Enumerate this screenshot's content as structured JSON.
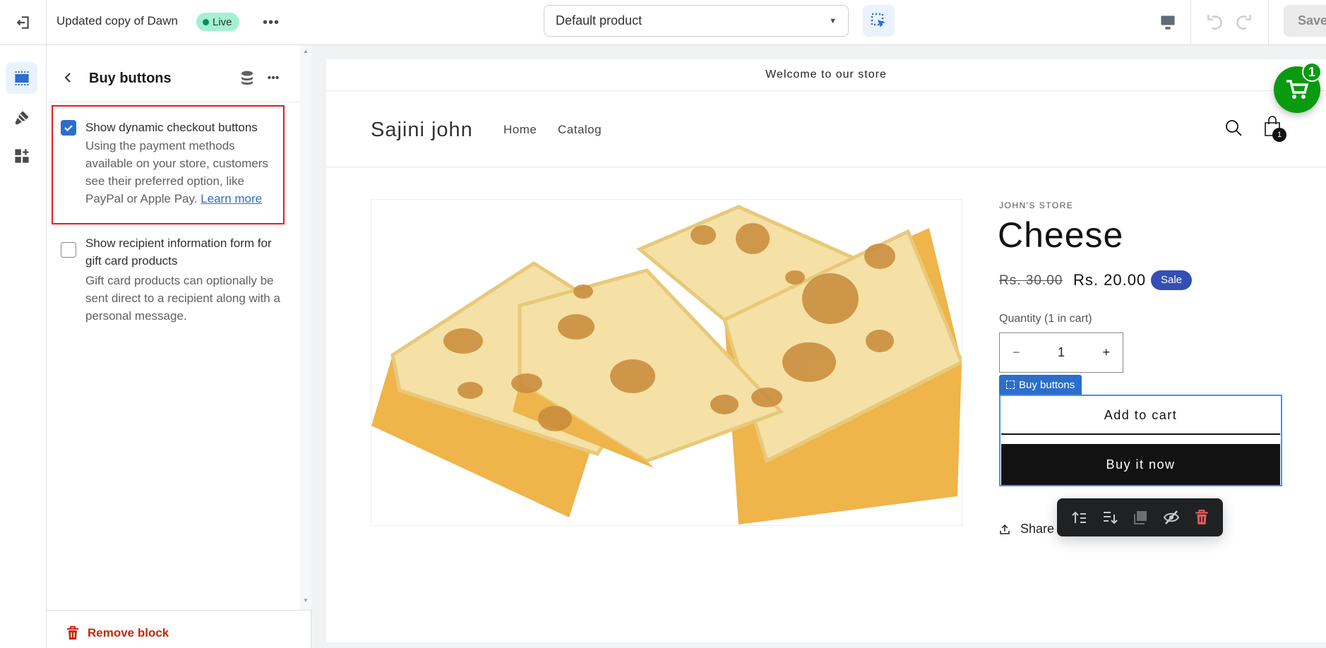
{
  "topbar": {
    "theme_name": "Updated copy of Dawn",
    "status_badge": "Live",
    "template_select": "Default product",
    "save_label": "Save"
  },
  "panel": {
    "title": "Buy buttons",
    "settings": [
      {
        "label": "Show dynamic checkout buttons",
        "checked": true,
        "description": "Using the payment methods available on your store, customers see their preferred option, like PayPal or Apple Pay.",
        "link": "Learn more"
      },
      {
        "label": "Show recipient information form for gift card products",
        "checked": false,
        "description": "Gift card products can optionally be sent direct to a recipient along with a personal message."
      }
    ],
    "remove_label": "Remove block"
  },
  "store": {
    "announcement": "Welcome to our store",
    "brand": "Sajini john",
    "nav": [
      "Home",
      "Catalog"
    ],
    "cart_count": "1",
    "floating_cart_count": "1",
    "vendor": "JOHN'S STORE",
    "product_title": "Cheese",
    "compare_price": "Rs. 30.00",
    "price": "Rs. 20.00",
    "sale_badge": "Sale",
    "quantity_label": "Quantity (1 in cart)",
    "quantity": "1",
    "block_tag": "Buy buttons",
    "add_to_cart": "Add to cart",
    "buy_now": "Buy it now",
    "share": "Share"
  },
  "colors": {
    "accent": "#2c6ecb",
    "live": "#a4f0d3",
    "sale": "#334fb4",
    "floating_cart": "#0a9a10",
    "highlight": "#e51c23"
  }
}
